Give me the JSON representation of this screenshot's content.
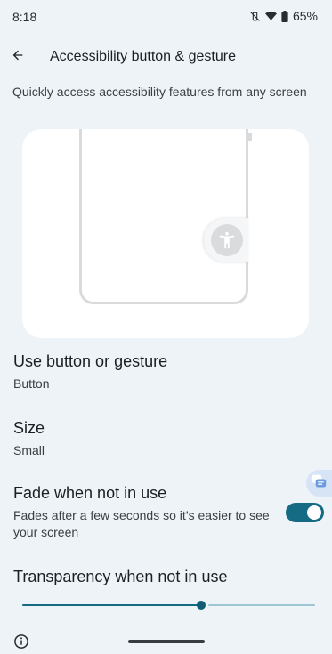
{
  "status_bar": {
    "time": "8:18",
    "battery": "65%",
    "icons": [
      "vibrate-off-icon",
      "wifi-icon",
      "battery-icon"
    ]
  },
  "header": {
    "title": "Accessibility button & gesture",
    "back_icon": "arrow-back-icon"
  },
  "description": "Quickly access accessibility features from any screen",
  "preview": {
    "floating_icon": "accessibility-person-icon"
  },
  "settings": {
    "use_button_or_gesture": {
      "title": "Use button or gesture",
      "value": "Button"
    },
    "size": {
      "title": "Size",
      "value": "Small"
    },
    "fade": {
      "title": "Fade when not in use",
      "summary": "Fades after a few seconds so it’s easier to see your screen",
      "enabled": true
    },
    "transparency": {
      "title": "Transparency when not in use",
      "level": 0.61
    }
  },
  "footer": {
    "info_icon": "info-icon"
  },
  "colors": {
    "accent": "#166B84",
    "background": "#EDF3F6",
    "card": "#FFFFFF"
  }
}
